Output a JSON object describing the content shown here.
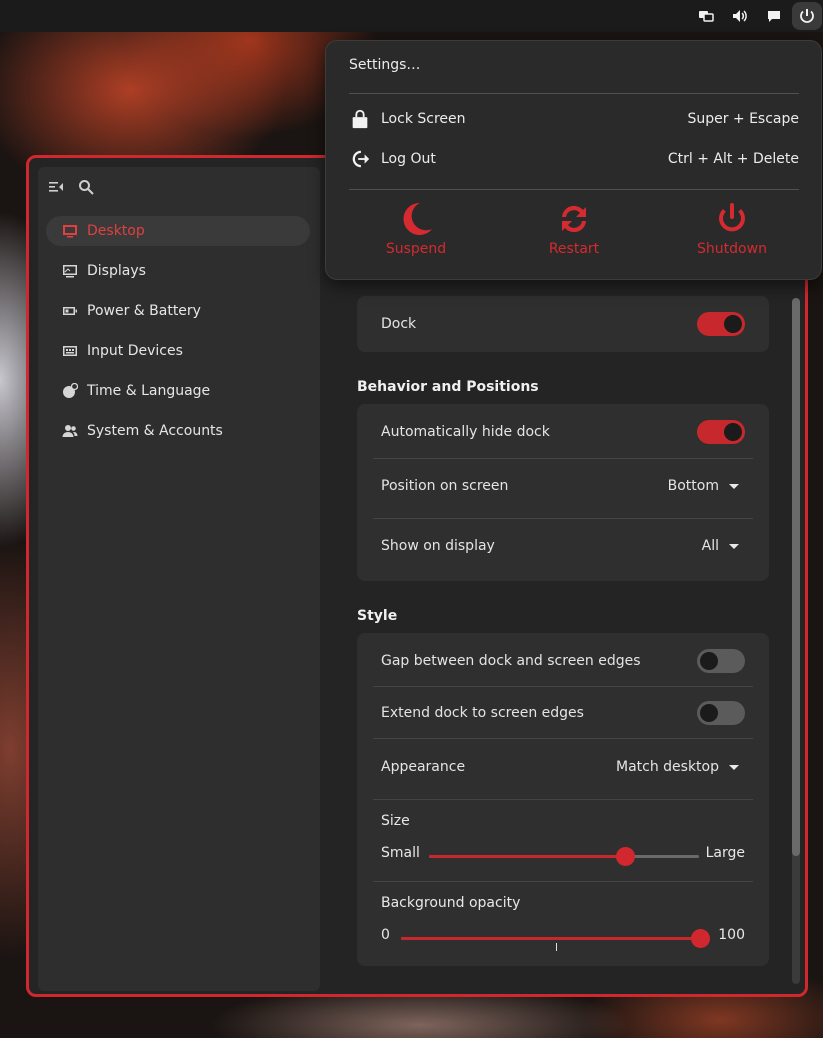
{
  "topbar": {
    "icons": [
      "network-icon",
      "volume-icon",
      "chat-icon",
      "power-icon"
    ]
  },
  "power_menu": {
    "settings_label": "Settings…",
    "lock_label": "Lock Screen",
    "lock_shortcut": "Super + Escape",
    "logout_label": "Log Out",
    "logout_shortcut": "Ctrl + Alt + Delete",
    "suspend_label": "Suspend",
    "restart_label": "Restart",
    "shutdown_label": "Shutdown"
  },
  "sidebar": {
    "items": [
      {
        "label": "Desktop",
        "icon": "monitor-icon",
        "active": true
      },
      {
        "label": "Displays",
        "icon": "displays-icon"
      },
      {
        "label": "Power & Battery",
        "icon": "battery-icon"
      },
      {
        "label": "Input Devices",
        "icon": "keyboard-icon"
      },
      {
        "label": "Time & Language",
        "icon": "globe-icon"
      },
      {
        "label": "System & Accounts",
        "icon": "people-icon"
      }
    ]
  },
  "dock": {
    "dock_label": "Dock",
    "dock_enabled": true,
    "behavior_title": "Behavior and Positions",
    "autohide_label": "Automatically hide dock",
    "autohide_enabled": true,
    "position_label": "Position on screen",
    "position_value": "Bottom",
    "show_on_label": "Show on display",
    "show_on_value": "All",
    "style_title": "Style",
    "gap_label": "Gap between dock and screen edges",
    "gap_enabled": false,
    "extend_label": "Extend dock to screen edges",
    "extend_enabled": false,
    "appearance_label": "Appearance",
    "appearance_value": "Match desktop",
    "size_label": "Size",
    "size_min": "Small",
    "size_max": "Large",
    "size_value": 0.73,
    "opacity_label": "Background opacity",
    "opacity_min": "0",
    "opacity_max": "100",
    "opacity_value": 100
  },
  "colors": {
    "accent": "#d0282e",
    "window_bg": "#242424",
    "card_bg": "#2f2f2f"
  }
}
